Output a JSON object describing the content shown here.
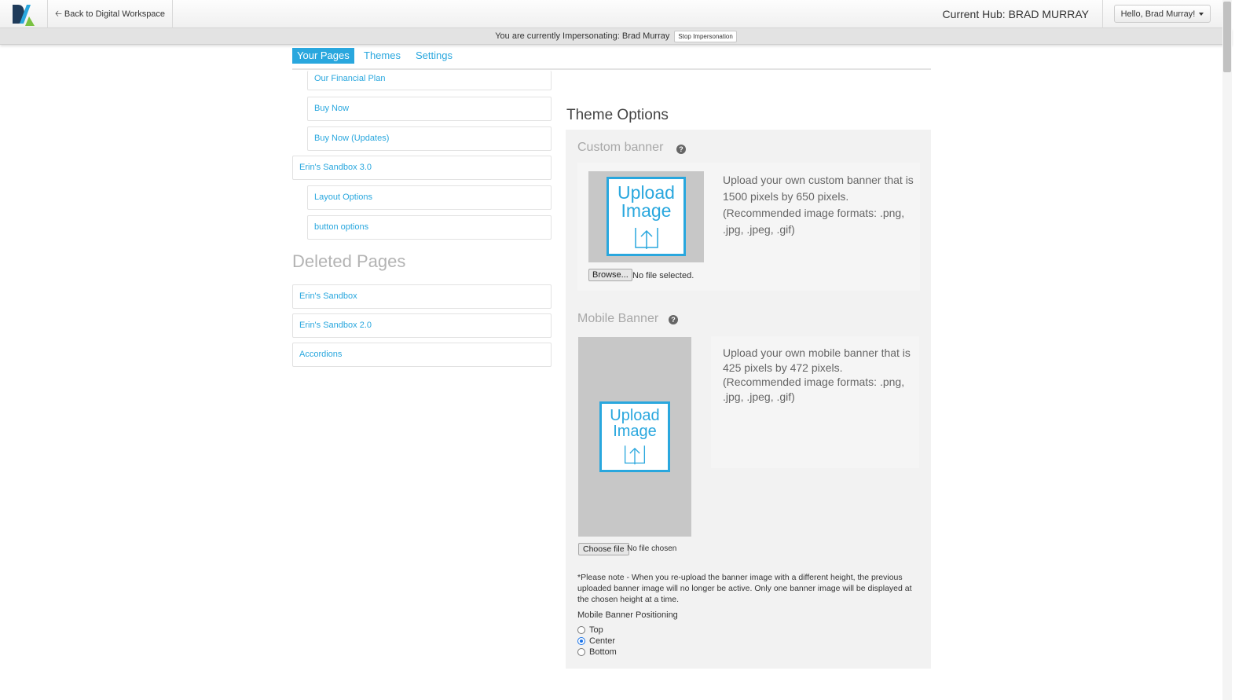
{
  "colors": {
    "accent": "#29a7de",
    "logo_dark": "#1f3b5a",
    "logo_green": "#7ac142"
  },
  "topbar": {
    "logo_icon": "da-logo-icon",
    "back_icon": "arrow-left-icon",
    "back_label": "Back to Digital Workspace",
    "hub_label": "Current Hub: BRAD MURRAY",
    "user_menu_label": "Hello, Brad Murray!"
  },
  "impersonation": {
    "text": "You are currently Impersonating: Brad Murray",
    "stop_label": "Stop Impersonation"
  },
  "tabs": [
    {
      "label": "Your Pages",
      "active": true
    },
    {
      "label": "Themes",
      "active": false
    },
    {
      "label": "Settings",
      "active": false
    }
  ],
  "pages": [
    {
      "label": "Our Financial Plan",
      "child": true
    },
    {
      "label": "Buy Now",
      "child": true
    },
    {
      "label": "Buy Now (Updates)",
      "child": true
    },
    {
      "label": "Erin's Sandbox 3.0",
      "child": false
    },
    {
      "label": "Layout Options",
      "child": true
    },
    {
      "label": "button options",
      "child": true
    }
  ],
  "deleted": {
    "heading": "Deleted Pages",
    "items": [
      "Erin's Sandbox",
      "Erin's Sandbox 2.0",
      "Accordions"
    ]
  },
  "theme": {
    "title": "Theme Options",
    "custom_banner": {
      "title": "Custom banner",
      "upload_text": [
        "Upload",
        "Image"
      ],
      "description": "Upload your own custom banner that is 1500 pixels by 650 pixels. (Recommended image formats: .png, .jpg, .jpeg, .gif)",
      "button_label": "Browse...",
      "status": "No file selected."
    },
    "mobile_banner": {
      "title": "Mobile Banner",
      "upload_text": [
        "Upload",
        "Image"
      ],
      "description": "Upload your own mobile banner that is 425 pixels by 472 pixels. (Recommended image formats: .png, .jpg, .jpeg, .gif)",
      "button_label": "Choose file",
      "status": "No file chosen"
    },
    "note": "*Please note - When you re-upload the banner image with a different height, the previous uploaded banner image will no longer be active. Only one banner image will be displayed at the chosen height at a time.",
    "positioning": {
      "label": "Mobile Banner Positioning",
      "options": [
        "Top",
        "Center",
        "Bottom"
      ],
      "selected": "Center"
    }
  }
}
